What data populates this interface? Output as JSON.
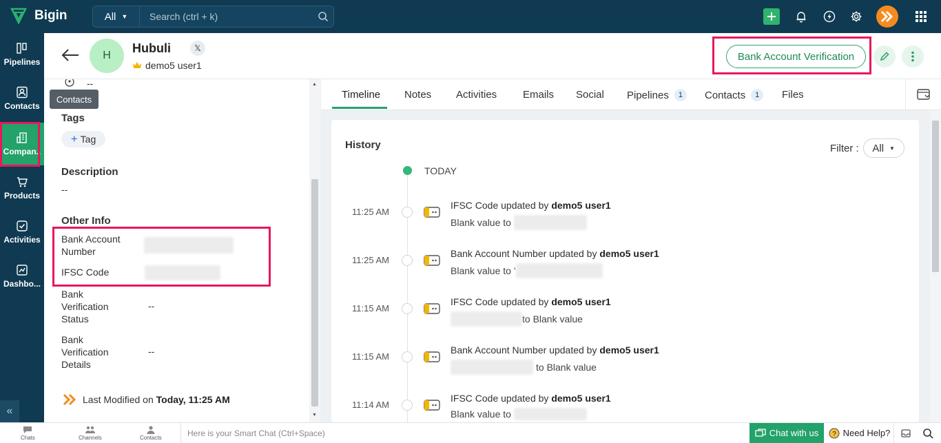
{
  "app": {
    "name": "Bigin"
  },
  "search": {
    "scope": "All",
    "placeholder": "Search (ctrl + k)"
  },
  "sidebar": {
    "items": [
      {
        "label": "Pipelines",
        "icon": "pipelines-icon"
      },
      {
        "label": "Contacts",
        "icon": "contacts-icon"
      },
      {
        "label": "Compan..",
        "icon": "companies-icon",
        "active": true
      },
      {
        "label": "Products",
        "icon": "products-icon"
      },
      {
        "label": "Activities",
        "icon": "activities-icon"
      },
      {
        "label": "Dashbo...",
        "icon": "dashboards-icon"
      }
    ],
    "tooltip": "Contacts",
    "collapse": "«"
  },
  "record": {
    "avatar_initial": "H",
    "name": "Hubuli",
    "owner": "demo5 user1",
    "primary_action": "Bank Account Verification"
  },
  "details": {
    "top_value": "--",
    "tags_heading": "Tags",
    "tag_button": "Tag",
    "description_heading": "Description",
    "description_value": "--",
    "other_info_heading": "Other Info",
    "fields": [
      {
        "label": "Bank Account Number",
        "value": ""
      },
      {
        "label": "IFSC Code",
        "value": ""
      },
      {
        "label": "Bank Verification Status",
        "value": "--"
      },
      {
        "label": "Bank Verification Details",
        "value": "--"
      }
    ],
    "last_modified_label": "Last Modified on",
    "last_modified_value": "Today, 11:25 AM"
  },
  "tabs": [
    {
      "label": "Timeline",
      "active": true
    },
    {
      "label": "Notes"
    },
    {
      "label": "Activities"
    },
    {
      "label": "Emails"
    },
    {
      "label": "Social"
    },
    {
      "label": "Pipelines",
      "badge": "1"
    },
    {
      "label": "Contacts",
      "badge": "1"
    },
    {
      "label": "Files"
    }
  ],
  "history": {
    "title": "History",
    "filter_label": "Filter :",
    "filter_value": "All",
    "today": "TODAY",
    "by_text": "updated by",
    "entries": [
      {
        "time": "11:25 AM",
        "field": "IFSC Code",
        "user": "demo5 user1",
        "sub_prefix": "Blank value to",
        "sub_suffix": ""
      },
      {
        "time": "11:25 AM",
        "field": "Bank Account Number",
        "user": "demo5 user1",
        "sub_prefix": "Blank value to '",
        "sub_suffix": ""
      },
      {
        "time": "11:15 AM",
        "field": "IFSC Code",
        "user": "demo5 user1",
        "sub_prefix": "",
        "sub_suffix": "to Blank value"
      },
      {
        "time": "11:15 AM",
        "field": "Bank Account Number",
        "user": "demo5 user1",
        "sub_prefix": "",
        "sub_suffix": "to Blank value"
      },
      {
        "time": "11:14 AM",
        "field": "IFSC Code",
        "user": "demo5 user1",
        "sub_prefix": "Blank value to",
        "sub_suffix": ""
      }
    ]
  },
  "footer": {
    "chats": "Chats",
    "channels": "Channels",
    "contacts": "Contacts",
    "smart_chat_placeholder": "Here is your Smart Chat (Ctrl+Space)",
    "chat_with_us": "Chat with us",
    "need_help": "Need Help?"
  },
  "colors": {
    "brand_dark": "#0f3a52",
    "accent_green": "#23a26a",
    "highlight": "#e8175d"
  }
}
